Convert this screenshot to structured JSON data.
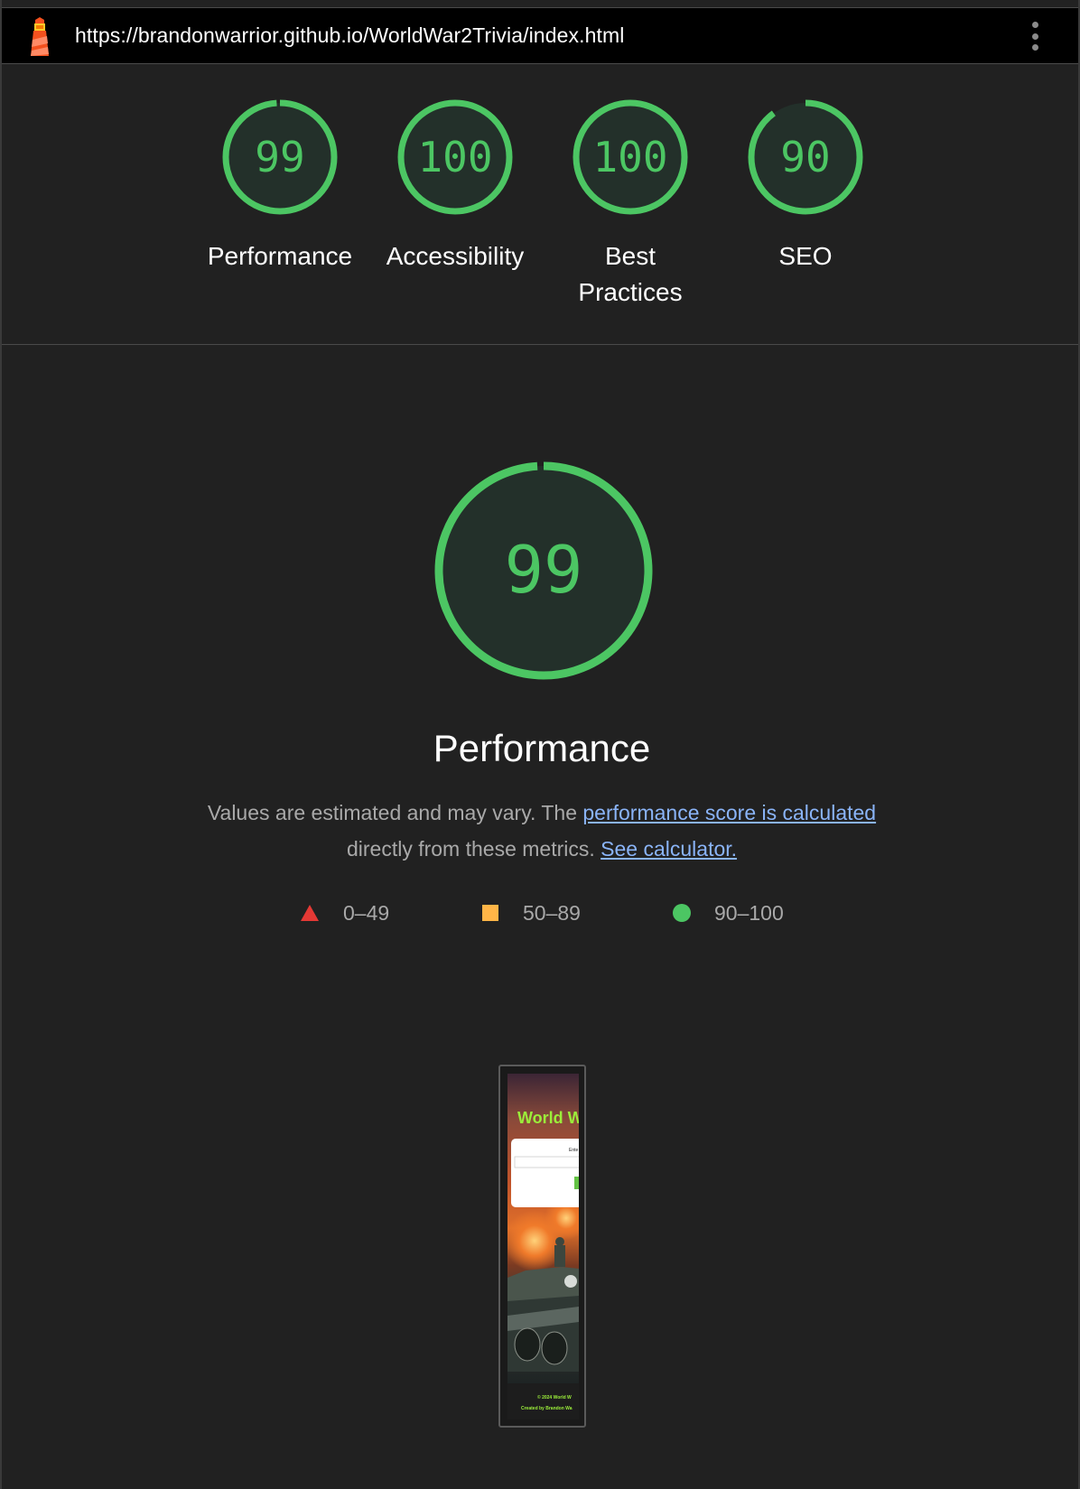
{
  "browser": {
    "url": "https://brandonwarrior.github.io/WorldWar2Trivia/index.html",
    "logo_icon": "lighthouse-icon",
    "menu_icon": "more-vertical-icon"
  },
  "categories": [
    {
      "label": "Performance",
      "score": "99",
      "fraction": 0.99
    },
    {
      "label": "Accessibility",
      "score": "100",
      "fraction": 1.0
    },
    {
      "label": "Best Practices",
      "score": "100",
      "fraction": 1.0
    },
    {
      "label": "SEO",
      "score": "90",
      "fraction": 0.9
    }
  ],
  "performance": {
    "score": "99",
    "fraction": 0.99,
    "title": "Performance",
    "description_prefix": "Values are estimated and may vary. The ",
    "link_calc": "performance score is calculated",
    "description_mid": " directly from these metrics. ",
    "link_calculator": "See calculator."
  },
  "legend": [
    {
      "shape": "triangle",
      "range": "0–49",
      "color": "#e53935"
    },
    {
      "shape": "square",
      "range": "50–89",
      "color": "#ffb547"
    },
    {
      "shape": "circle",
      "range": "90–100",
      "color": "#4cc663"
    }
  ],
  "screenshot": {
    "site_title": "World W",
    "form_heading": "Ente",
    "footer_line1": "© 2024 World W",
    "footer_line2": "Created by Brandon Wa"
  },
  "colors": {
    "pass": "#4cc663",
    "pass_bg": "#23302a",
    "link": "#8ab4f8",
    "background": "#212121"
  }
}
